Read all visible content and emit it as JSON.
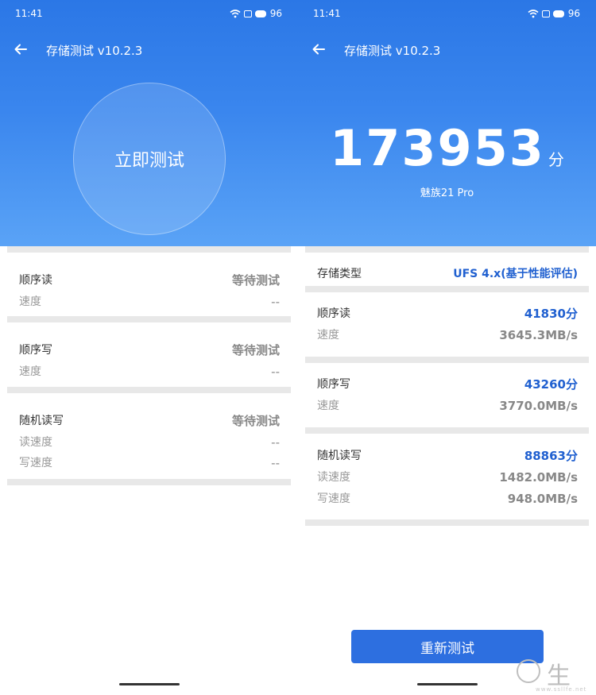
{
  "status": {
    "time": "11:41",
    "battery": "96"
  },
  "left_screen": {
    "title": "存储测试 v10.2.3",
    "start_button": "立即测试",
    "sections": [
      {
        "title": "顺序读",
        "status": "等待测试",
        "rows": [
          {
            "label": "速度",
            "value": "--"
          }
        ]
      },
      {
        "title": "顺序写",
        "status": "等待测试",
        "rows": [
          {
            "label": "速度",
            "value": "--"
          }
        ]
      },
      {
        "title": "随机读写",
        "status": "等待测试",
        "rows": [
          {
            "label": "读速度",
            "value": "--"
          },
          {
            "label": "写速度",
            "value": "--"
          }
        ]
      }
    ]
  },
  "right_screen": {
    "title": "存储测试 v10.2.3",
    "score": "173953",
    "score_unit": "分",
    "device": "魅族21 Pro",
    "storage_type_label": "存储类型",
    "storage_type_value": "UFS 4.x(基于性能评估)",
    "sections": [
      {
        "title": "顺序读",
        "score": "41830分",
        "rows": [
          {
            "label": "速度",
            "value": "3645.3MB/s"
          }
        ]
      },
      {
        "title": "顺序写",
        "score": "43260分",
        "rows": [
          {
            "label": "速度",
            "value": "3770.0MB/s"
          }
        ]
      },
      {
        "title": "随机读写",
        "score": "88863分",
        "rows": [
          {
            "label": "读速度",
            "value": "1482.0MB/s"
          },
          {
            "label": "写速度",
            "value": "948.0MB/s"
          }
        ]
      }
    ],
    "retest_button": "重新测试"
  },
  "watermark": {
    "text": "生活",
    "url": "www.ssllfe.net"
  },
  "colors": {
    "accent": "#2b77e6",
    "score_blue": "#2060d0",
    "button": "#2d6fe0",
    "divider": "#e8e8e8"
  }
}
